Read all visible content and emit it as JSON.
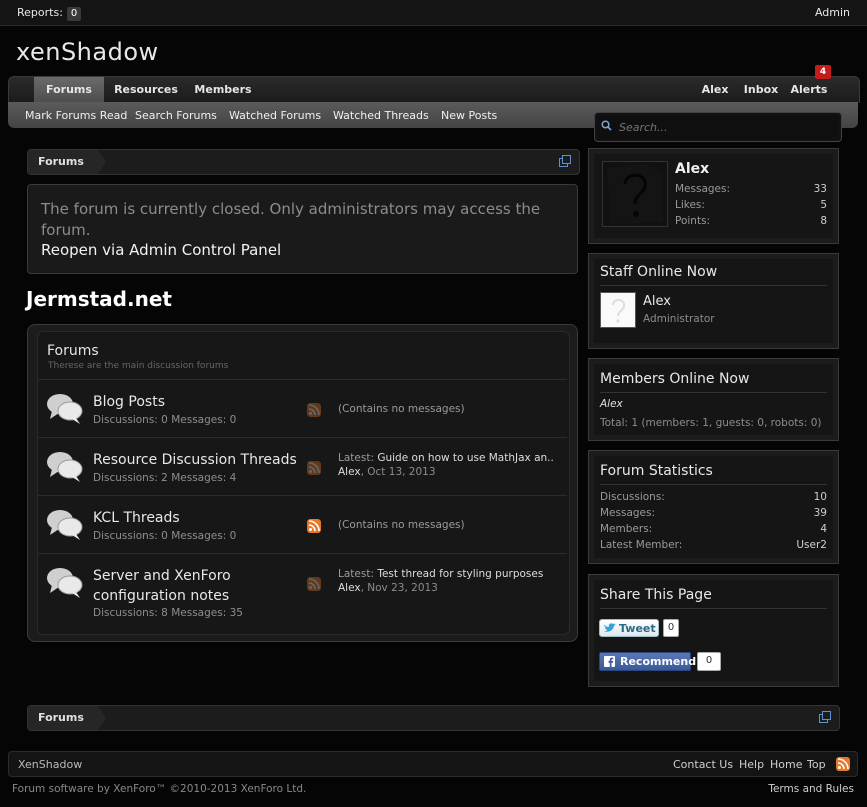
{
  "adminbar": {
    "reports_label": "Reports:",
    "reports_count": "0",
    "admin_label": "Admin"
  },
  "logo": "xenShadow",
  "nav": {
    "tabs": [
      "Forums",
      "Resources",
      "Members"
    ],
    "right": [
      "Alex",
      "Inbox",
      "Alerts"
    ],
    "alerts_count": "4",
    "subtabs": [
      "Mark Forums Read",
      "Search Forums",
      "Watched Forums",
      "Watched Threads",
      "New Posts"
    ]
  },
  "search": {
    "placeholder": "Search..."
  },
  "breadcrumb": {
    "label": "Forums"
  },
  "notice": {
    "text": "The forum is currently closed. Only administrators may access the forum.",
    "link": "Reopen via Admin Control Panel"
  },
  "site_title": "Jermstad.net",
  "category": {
    "title": "Forums",
    "description": "Therese are the main discussion forums"
  },
  "forums": [
    {
      "name": "Blog Posts",
      "stats": "Discussions: 0 Messages: 0",
      "latest_prefix": "",
      "latest_title": "",
      "latest_user": "",
      "latest_date": "",
      "none": "(Contains no messages)"
    },
    {
      "name": "Resource Discussion Threads",
      "stats": "Discussions: 2 Messages: 4",
      "latest_prefix": "Latest:",
      "latest_title": "Guide on how to use MathJax an...",
      "latest_user": "Alex",
      "latest_date": ", Oct 13, 2013",
      "none": ""
    },
    {
      "name": "KCL Threads",
      "stats": "Discussions: 0 Messages: 0",
      "latest_prefix": "",
      "latest_title": "",
      "latest_user": "",
      "latest_date": "",
      "none": "(Contains no messages)"
    },
    {
      "name_line1": "Server and XenForo",
      "name_line2": "configuration notes",
      "stats": "Discussions: 8 Messages: 35",
      "latest_prefix": "Latest:",
      "latest_title": "Test thread for styling purposes",
      "latest_user": "Alex",
      "latest_date": ", Nov 23, 2013",
      "none": ""
    }
  ],
  "visitor": {
    "name": "Alex",
    "messages_label": "Messages:",
    "messages": "33",
    "likes_label": "Likes:",
    "likes": "5",
    "points_label": "Points:",
    "points": "8"
  },
  "staff": {
    "title": "Staff Online Now",
    "name": "Alex",
    "role": "Administrator"
  },
  "members_online": {
    "title": "Members Online Now",
    "name": "Alex",
    "total": "Total: 1 (members: 1, guests: 0, robots: 0)"
  },
  "stats": {
    "title": "Forum Statistics",
    "discussions_label": "Discussions:",
    "discussions": "10",
    "messages_label": "Messages:",
    "messages": "39",
    "members_label": "Members:",
    "members": "4",
    "latest_label": "Latest Member:",
    "latest": "User2"
  },
  "share": {
    "title": "Share This Page",
    "tweet": "Tweet",
    "tweet_count": "0",
    "fb": "Recommend",
    "fb_count": "0"
  },
  "footer": {
    "name": "XenShadow",
    "links": [
      "Contact Us",
      "Help",
      "Home",
      "Top"
    ],
    "copyright": "Forum software by XenForo™ ©2010-2013 XenForo Ltd.",
    "terms": "Terms and Rules"
  },
  "colors": {
    "alert": "#c21c1c",
    "rss": "#e8792b",
    "fb": "#3b5998"
  }
}
